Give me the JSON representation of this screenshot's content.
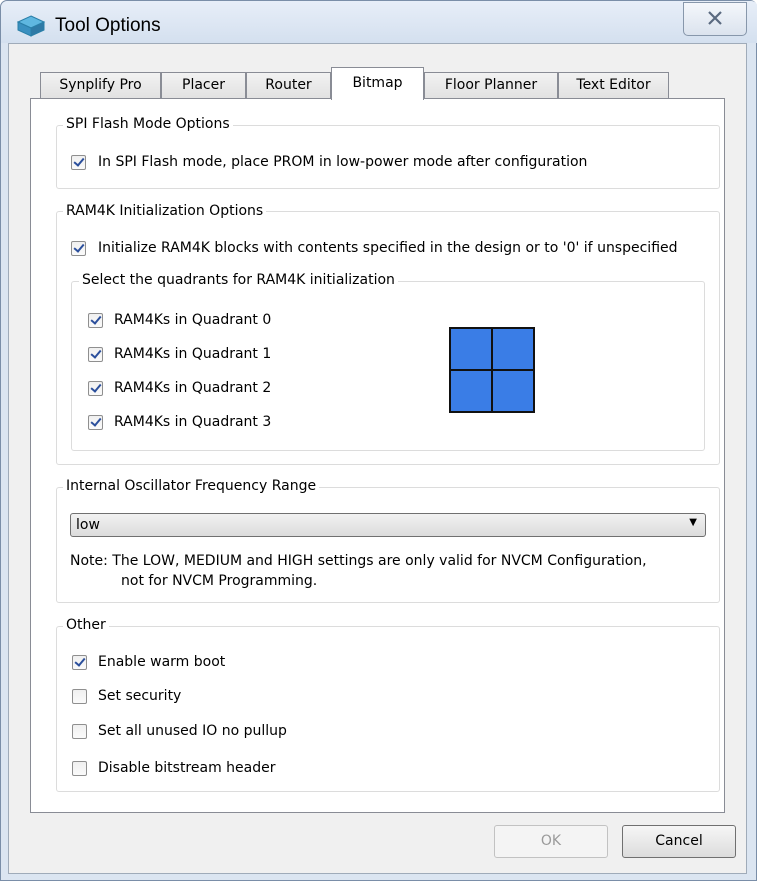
{
  "window": {
    "title": "Tool Options"
  },
  "tabs": [
    {
      "label": "Synplify Pro"
    },
    {
      "label": "Placer"
    },
    {
      "label": "Router"
    },
    {
      "label": "Bitmap",
      "active": true
    },
    {
      "label": "Floor Planner"
    },
    {
      "label": "Text Editor"
    }
  ],
  "spi": {
    "legend": "SPI Flash Mode Options",
    "low_power": {
      "label": "In SPI Flash mode, place PROM in low-power mode after configuration",
      "checked": true
    }
  },
  "ram4k": {
    "legend": "RAM4K Initialization Options",
    "init": {
      "label": "Initialize RAM4K blocks with contents specified in the design or to '0' if unspecified",
      "checked": true
    },
    "quadrants_legend": "Select the quadrants for RAM4K initialization",
    "quadrants": [
      {
        "label": "RAM4Ks in Quadrant 0",
        "checked": true
      },
      {
        "label": "RAM4Ks in Quadrant 1",
        "checked": true
      },
      {
        "label": "RAM4Ks in Quadrant 2",
        "checked": true
      },
      {
        "label": "RAM4Ks in Quadrant 3",
        "checked": true
      }
    ],
    "quadrant_color": "#3a7de6"
  },
  "oscillator": {
    "legend": "Internal Oscillator Frequency Range",
    "selected": "low",
    "note_line1": "Note: The LOW, MEDIUM and HIGH settings are only valid for NVCM Configuration,",
    "note_line2": "not for NVCM Programming."
  },
  "other": {
    "legend": "Other",
    "options": [
      {
        "label": "Enable warm boot",
        "checked": true
      },
      {
        "label": "Set security",
        "checked": false
      },
      {
        "label": "Set all unused IO no pullup",
        "checked": false
      },
      {
        "label": "Disable bitstream header",
        "checked": false
      }
    ]
  },
  "buttons": {
    "ok": "OK",
    "cancel": "Cancel"
  }
}
